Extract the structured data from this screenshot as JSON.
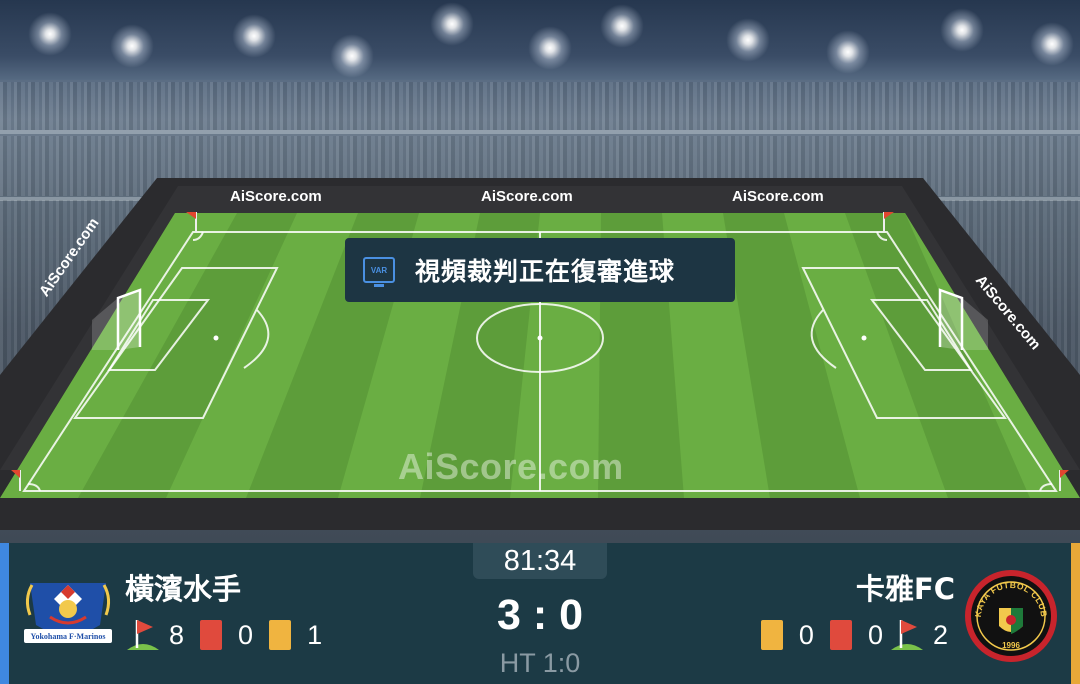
{
  "sponsor": {
    "board_top_left": "AiScore.com",
    "board_top_center": "AiScore.com",
    "board_top_right": "AiScore.com",
    "board_side_left": "AiScore.com",
    "board_side_right": "AiScore.com",
    "pitch_watermark": "AiScore.com"
  },
  "event": {
    "var_icon_label": "VAR",
    "var_message": "視頻裁判正在復審進球"
  },
  "match": {
    "clock": "81:34",
    "score": "3 : 0",
    "halftime": "HT 1:0"
  },
  "home": {
    "name": "橫濱水手",
    "logo_text": "Yokohama F·Marinos",
    "accent_color": "#3f88e0",
    "corners": "8",
    "red_cards": "0",
    "yellow_cards": "1"
  },
  "away": {
    "name": "卡雅FC",
    "logo_text_top": "KAYA FUTBOL CLUB",
    "logo_year": "1996",
    "accent_color": "#e8a838",
    "yellow_cards": "0",
    "red_cards": "0",
    "corners": "2"
  }
}
